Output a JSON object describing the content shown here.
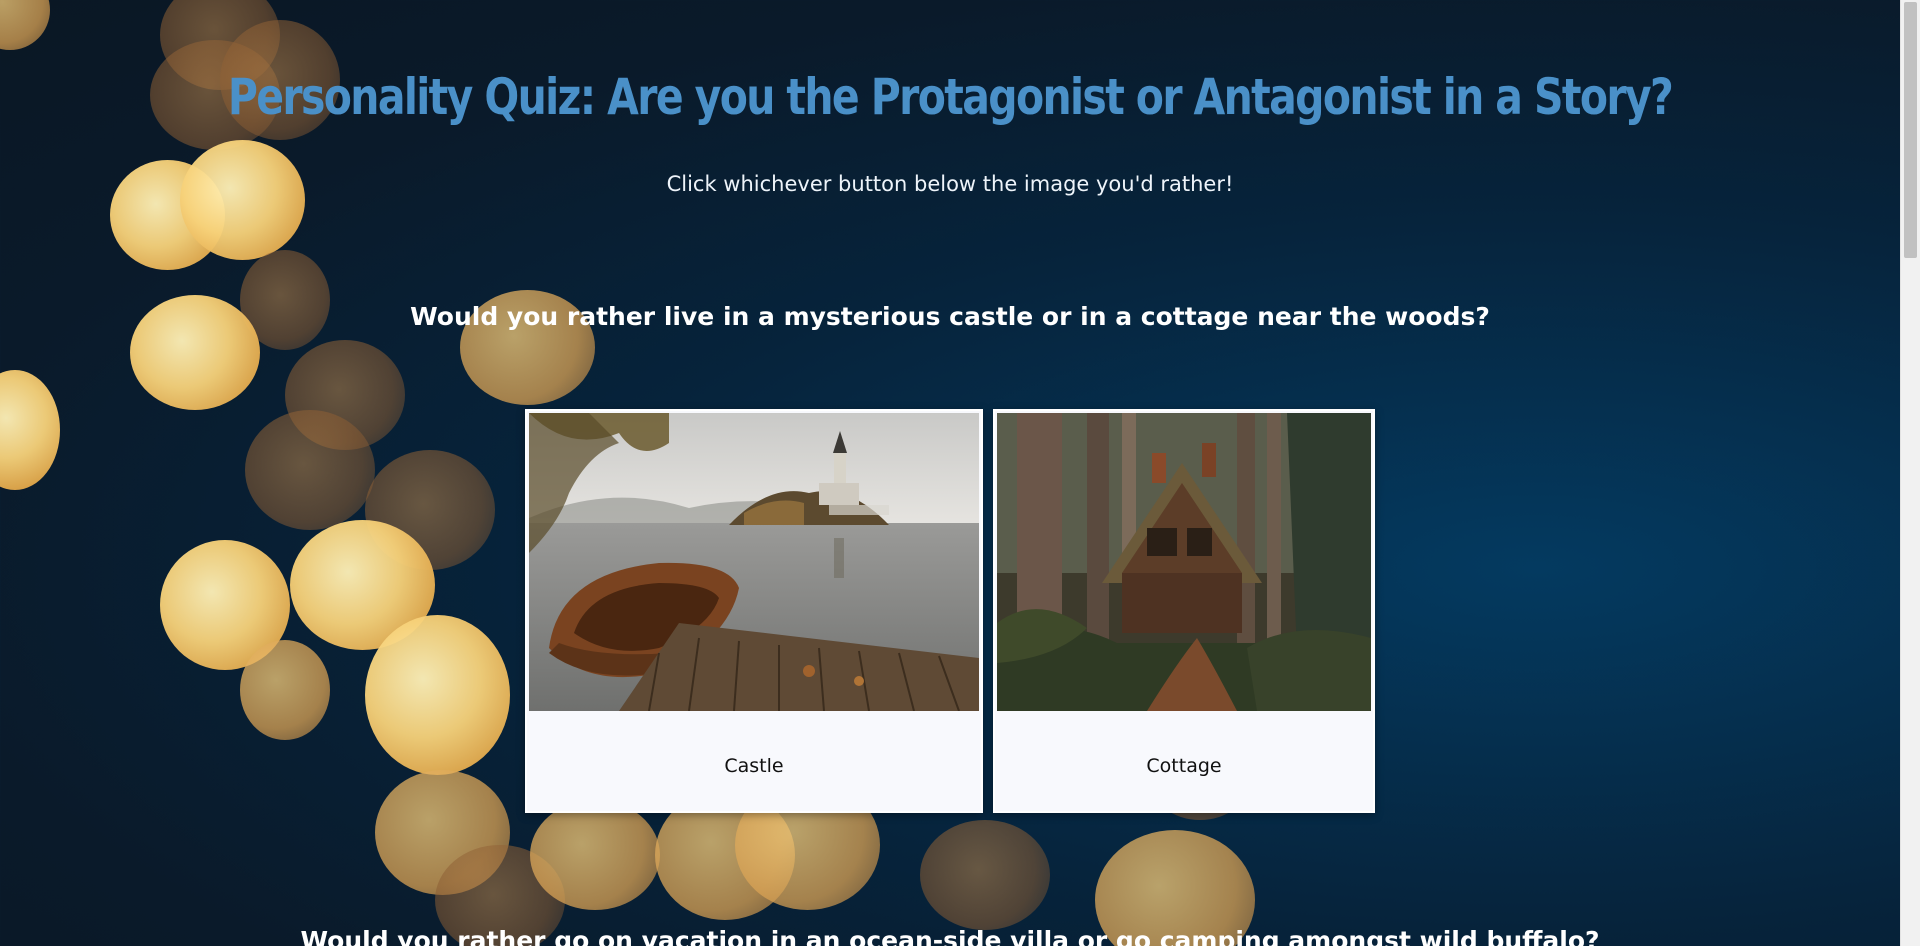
{
  "page": {
    "title": "Personality Quiz: Are you the Protagonist or Antagonist in a Story?",
    "subtitle": "Click whichever button below the image you'd rather!"
  },
  "questions": [
    {
      "text": "Would you rather live in a mysterious castle or in a cottage near the woods?",
      "options": [
        {
          "label": "Castle",
          "image": "castle-lake-boat-image"
        },
        {
          "label": "Cottage",
          "image": "forest-cottage-image"
        }
      ]
    },
    {
      "text": "Would you rather go on vacation in an ocean-side villa or go camping amongst wild buffalo?"
    }
  ],
  "colors": {
    "title": "#4a90c8",
    "background_dark": "#0a1724",
    "background_blue": "#043a60",
    "bokeh": "#f7d27a",
    "card": "#f8f9fd"
  }
}
